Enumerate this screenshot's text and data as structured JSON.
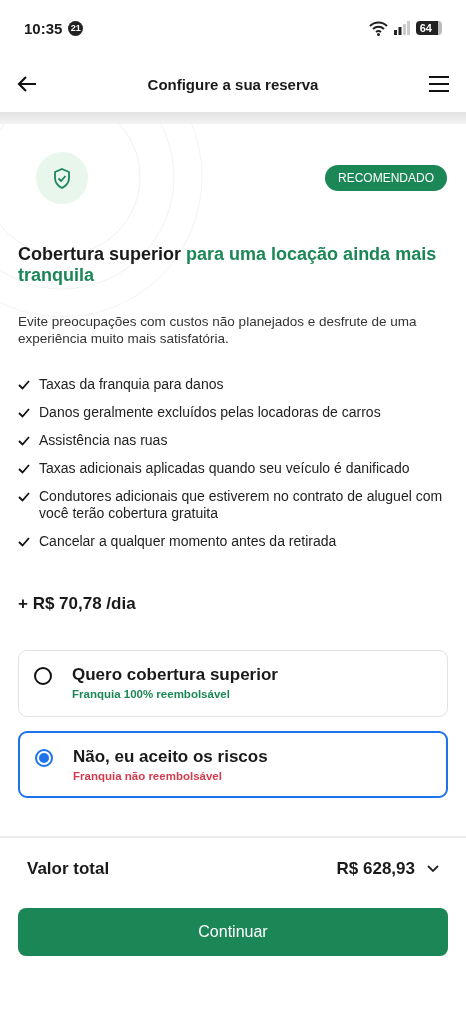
{
  "status_bar": {
    "time": "10:35",
    "notification_count": "21",
    "battery": "64"
  },
  "header": {
    "title": "Configure a sua reserva"
  },
  "coverage": {
    "badge": "RECOMENDADO",
    "title_lead": "Cobertura superior",
    "title_highlight": "para uma locação ainda mais tranquila",
    "description": "Evite preocupações com custos não planejados e desfrute de uma experiência muito mais satisfatória.",
    "benefits": [
      "Taxas da franquia para danos",
      "Danos geralmente excluídos pelas locadoras de carros",
      "Assistência nas ruas",
      "Taxas adicionais aplicadas quando seu veículo é danificado",
      "Condutores adicionais que estiverem no contrato de aluguel com você terão cobertura gratuita",
      "Cancelar a qualquer momento antes da retirada"
    ],
    "price": "+ R$ 70,78 /dia"
  },
  "options": [
    {
      "label": "Quero cobertura superior",
      "note": "Franquia 100% reembolsável",
      "kind": "positive",
      "selected": false
    },
    {
      "label": "Não, eu aceito os riscos",
      "note": "Franquia não reembolsável",
      "kind": "negative",
      "selected": true
    }
  ],
  "footer": {
    "total_label": "Valor total",
    "total_value": "R$ 628,93",
    "button": "Continuar"
  }
}
